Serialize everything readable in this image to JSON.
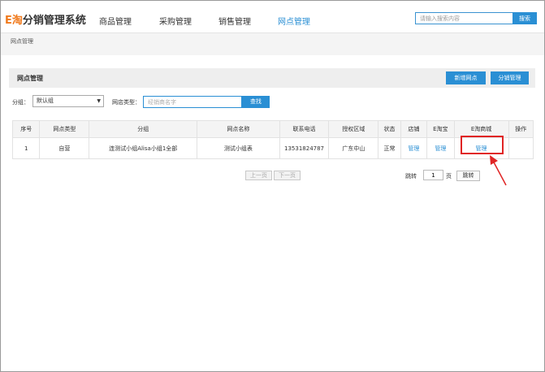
{
  "header": {
    "logo_prefix": "E淘",
    "logo_text": "分销管理系统",
    "nav": [
      "商品管理",
      "采购管理",
      "销售管理",
      "网点管理"
    ],
    "search_placeholder": "请输入搜索内容",
    "search_button": "搜索"
  },
  "breadcrumb": "网点管理",
  "panel": {
    "title": "网点管理",
    "new_button": "新增网点",
    "distribution_button": "分销管理"
  },
  "filters": {
    "group_label": "分组：",
    "group_value": "默认组",
    "type_label": "网店类型：",
    "type_placeholder": "经销商名字",
    "find_button": "查找"
  },
  "table": {
    "columns": [
      "序号",
      "网点类型",
      "分组",
      "网点名称",
      "联系电话",
      "授权区域",
      "状态",
      "店铺",
      "E淘宝",
      "E淘商城",
      "操作"
    ],
    "rows": [
      [
        "1",
        "自营",
        "连测试小组Alisa小组1全部",
        "测试小组表",
        "13531824787",
        "广东中山",
        "正常",
        "管理",
        "管理",
        "管理",
        ""
      ]
    ]
  },
  "pager": {
    "prev": "上一页",
    "next": "下一页",
    "jump_label": "跳转",
    "page_value": "1",
    "page_unit": "页",
    "go_button": "跳转"
  },
  "colors": {
    "accent": "#2a8fd4",
    "logo_orange": "#f07a1d",
    "highlight_red": "#e02424"
  }
}
